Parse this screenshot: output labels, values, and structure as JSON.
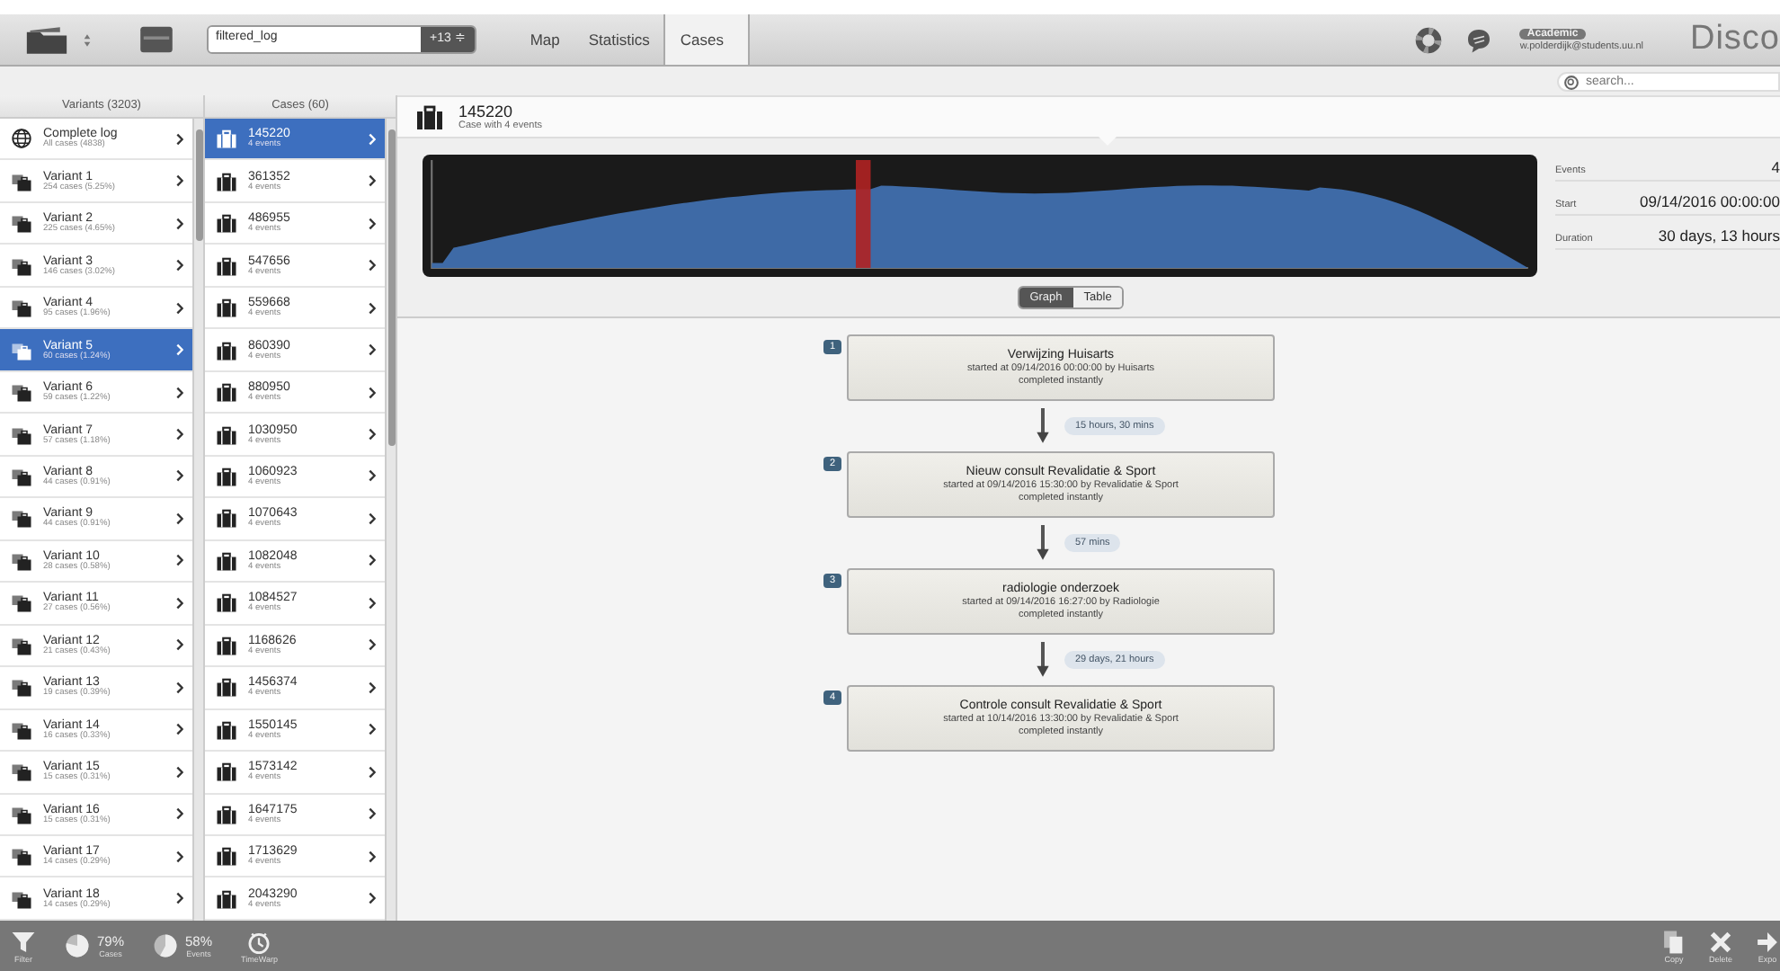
{
  "toolbar": {
    "file_name": "filtered_log",
    "file_count": "+13 ≑",
    "tabs": [
      {
        "label": "Map",
        "selected": false
      },
      {
        "label": "Statistics",
        "selected": false
      },
      {
        "label": "Cases",
        "selected": true
      }
    ],
    "license": "Academic",
    "user": "w.polderdijk@students.uu.nl",
    "brand": "Disco"
  },
  "search": {
    "placeholder": "search..."
  },
  "variants": {
    "header": "Variants (3203)",
    "items": [
      {
        "kind": "all",
        "title": "Complete log",
        "subtitle": "All cases (4838)",
        "selected": false
      },
      {
        "kind": "variant",
        "title": "Variant 1",
        "subtitle": "254 cases (5.25%)",
        "selected": false
      },
      {
        "kind": "variant",
        "title": "Variant 2",
        "subtitle": "225 cases (4.65%)",
        "selected": false
      },
      {
        "kind": "variant",
        "title": "Variant 3",
        "subtitle": "146 cases (3.02%)",
        "selected": false
      },
      {
        "kind": "variant",
        "title": "Variant 4",
        "subtitle": "95 cases (1.96%)",
        "selected": false
      },
      {
        "kind": "variant",
        "title": "Variant 5",
        "subtitle": "60 cases (1.24%)",
        "selected": true
      },
      {
        "kind": "variant",
        "title": "Variant 6",
        "subtitle": "59 cases (1.22%)",
        "selected": false
      },
      {
        "kind": "variant",
        "title": "Variant 7",
        "subtitle": "57 cases (1.18%)",
        "selected": false
      },
      {
        "kind": "variant",
        "title": "Variant 8",
        "subtitle": "44 cases (0.91%)",
        "selected": false
      },
      {
        "kind": "variant",
        "title": "Variant 9",
        "subtitle": "44 cases (0.91%)",
        "selected": false
      },
      {
        "kind": "variant",
        "title": "Variant 10",
        "subtitle": "28 cases (0.58%)",
        "selected": false
      },
      {
        "kind": "variant",
        "title": "Variant 11",
        "subtitle": "27 cases (0.56%)",
        "selected": false
      },
      {
        "kind": "variant",
        "title": "Variant 12",
        "subtitle": "21 cases (0.43%)",
        "selected": false
      },
      {
        "kind": "variant",
        "title": "Variant 13",
        "subtitle": "19 cases (0.39%)",
        "selected": false
      },
      {
        "kind": "variant",
        "title": "Variant 14",
        "subtitle": "16 cases (0.33%)",
        "selected": false
      },
      {
        "kind": "variant",
        "title": "Variant 15",
        "subtitle": "15 cases (0.31%)",
        "selected": false
      },
      {
        "kind": "variant",
        "title": "Variant 16",
        "subtitle": "15 cases (0.31%)",
        "selected": false
      },
      {
        "kind": "variant",
        "title": "Variant 17",
        "subtitle": "14 cases (0.29%)",
        "selected": false
      },
      {
        "kind": "variant",
        "title": "Variant 18",
        "subtitle": "14 cases (0.29%)",
        "selected": false
      }
    ]
  },
  "cases": {
    "header": "Cases (60)",
    "items": [
      {
        "title": "145220",
        "subtitle": "4 events",
        "selected": true
      },
      {
        "title": "361352",
        "subtitle": "4 events",
        "selected": false
      },
      {
        "title": "486955",
        "subtitle": "4 events",
        "selected": false
      },
      {
        "title": "547656",
        "subtitle": "4 events",
        "selected": false
      },
      {
        "title": "559668",
        "subtitle": "4 events",
        "selected": false
      },
      {
        "title": "860390",
        "subtitle": "4 events",
        "selected": false
      },
      {
        "title": "880950",
        "subtitle": "4 events",
        "selected": false
      },
      {
        "title": "1030950",
        "subtitle": "4 events",
        "selected": false
      },
      {
        "title": "1060923",
        "subtitle": "4 events",
        "selected": false
      },
      {
        "title": "1070643",
        "subtitle": "4 events",
        "selected": false
      },
      {
        "title": "1082048",
        "subtitle": "4 events",
        "selected": false
      },
      {
        "title": "1084527",
        "subtitle": "4 events",
        "selected": false
      },
      {
        "title": "1168626",
        "subtitle": "4 events",
        "selected": false
      },
      {
        "title": "1456374",
        "subtitle": "4 events",
        "selected": false
      },
      {
        "title": "1550145",
        "subtitle": "4 events",
        "selected": false
      },
      {
        "title": "1573142",
        "subtitle": "4 events",
        "selected": false
      },
      {
        "title": "1647175",
        "subtitle": "4 events",
        "selected": false
      },
      {
        "title": "1713629",
        "subtitle": "4 events",
        "selected": false
      },
      {
        "title": "2043290",
        "subtitle": "4 events",
        "selected": false
      }
    ]
  },
  "case_detail": {
    "title": "145220",
    "subtitle": "Case with 4 events",
    "stats": [
      {
        "label": "Events",
        "value": "4"
      },
      {
        "label": "Start",
        "value": "09/14/2016 00:00:00"
      },
      {
        "label": "Duration",
        "value": "30 days, 13 hours"
      }
    ],
    "view_toggle": [
      {
        "label": "Graph",
        "selected": true
      },
      {
        "label": "Table",
        "selected": false
      }
    ],
    "events": [
      {
        "number": "1",
        "name": "Verwijzing Huisarts",
        "started": "started at 09/14/2016 00:00:00 by Huisarts",
        "completed": "completed instantly"
      },
      {
        "gap": "15 hours, 30 mins",
        "number": "2",
        "name": "Nieuw consult Revalidatie & Sport",
        "started": "started at 09/14/2016 15:30:00 by Revalidatie & Sport",
        "completed": "completed instantly"
      },
      {
        "gap": "57 mins",
        "number": "3",
        "name": "radiologie onderzoek",
        "started": "started at 09/14/2016 16:27:00 by Radiologie",
        "completed": "completed instantly"
      },
      {
        "gap": "29 days, 21 hours",
        "number": "4",
        "name": "Controle consult Revalidatie & Sport",
        "started": "started at 10/14/2016 13:30:00 by Revalidatie & Sport",
        "completed": "completed instantly"
      }
    ]
  },
  "bottom_bar": {
    "left": [
      {
        "kind": "filter",
        "label": "Filter"
      },
      {
        "kind": "pie",
        "value": "79%",
        "label": "Cases"
      },
      {
        "kind": "pie",
        "value": "58%",
        "label": "Events"
      },
      {
        "kind": "timewarp",
        "label": "TimeWarp"
      }
    ],
    "right": [
      {
        "kind": "copy",
        "label": "Copy"
      },
      {
        "kind": "delete",
        "label": "Delete"
      },
      {
        "kind": "export",
        "label": "Expo"
      }
    ]
  }
}
